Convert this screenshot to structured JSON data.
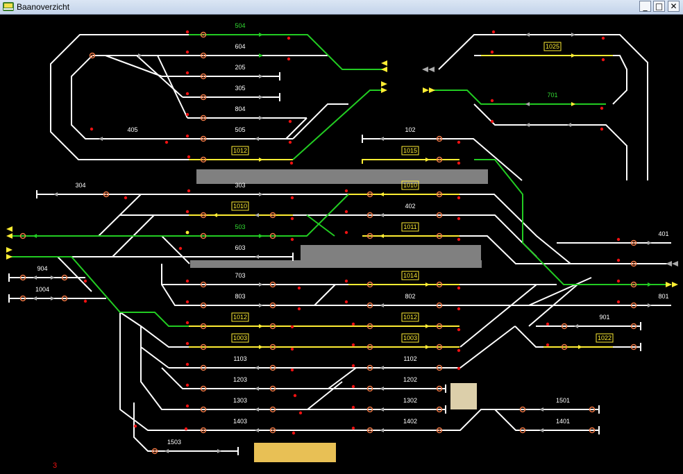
{
  "window": {
    "title": "Baanoverzicht",
    "buttons": {
      "minimize": "_",
      "maximize": "□",
      "close": "✕"
    }
  },
  "colors": {
    "track": "#ffffff",
    "route": "#22cc22",
    "reserved": "#ffee33",
    "signal_red": "#ee1111",
    "signal_ring": "#ee7744",
    "gray": "#808080",
    "label": "#ffffff",
    "green_label": "#33dd33",
    "counter": "#ee1111"
  },
  "labels": {
    "t504": "504",
    "t604": "604",
    "t205": "205",
    "t305": "305",
    "t804": "804",
    "t405": "405",
    "t505": "505",
    "t102": "102",
    "t304": "304",
    "t303": "303",
    "t402": "402",
    "t503": "503",
    "t603": "603",
    "t401": "401",
    "t904": "904",
    "t1004": "1004",
    "t703": "703",
    "t803": "803",
    "t802": "802",
    "t801": "801",
    "t901": "901",
    "t1103": "1103",
    "t1102": "1102",
    "t1203": "1203",
    "t1202": "1202",
    "t1303": "1303",
    "t1302": "1302",
    "t1501": "1501",
    "t1403": "1403",
    "t1402": "1402",
    "t1401": "1401",
    "t1503": "1503",
    "t701": "701"
  },
  "trains": {
    "tr1025": "1025",
    "tr1012a": "1012",
    "tr1015": "1015",
    "tr1010a": "1010",
    "tr1010b": "1010",
    "tr1011": "1011",
    "tr1014": "1014",
    "tr1012b": "1012",
    "tr1012c": "1012",
    "tr1003a": "1003",
    "tr1003b": "1003",
    "tr1022": "1022"
  },
  "status": {
    "counter": "3"
  }
}
